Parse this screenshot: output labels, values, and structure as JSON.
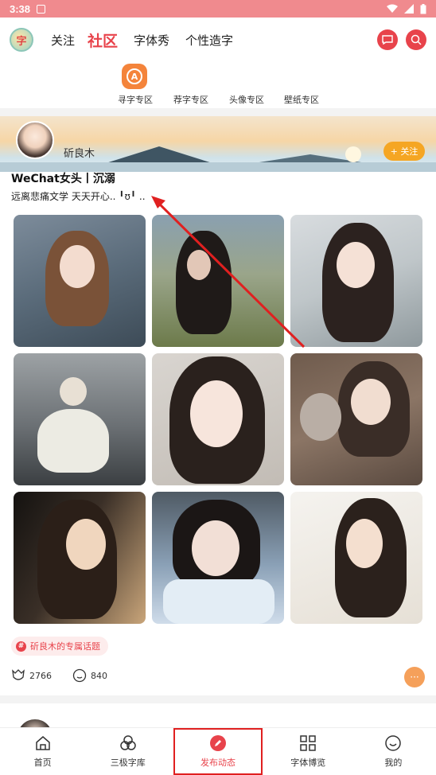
{
  "status_bar": {
    "time": "3:38"
  },
  "top_nav": {
    "logo_text": "字",
    "tabs": [
      {
        "label": "关注"
      },
      {
        "label": "社区"
      },
      {
        "label": "字体秀"
      },
      {
        "label": "个性造字"
      }
    ]
  },
  "sub_zones": [
    {
      "label": "寻字专区"
    },
    {
      "label": "荐字专区"
    },
    {
      "label": "头像专区"
    },
    {
      "label": "壁纸专区"
    }
  ],
  "post": {
    "username": "斫良木",
    "follow_label": "+ 关注",
    "title": "WeChat女头丨沉溺",
    "subtitle": "远离悲痛文学 天天开心.. ╹ʊ╹ ..",
    "tag": "斫良木的专属话题",
    "likes": "2766",
    "comments": "840",
    "more": "···"
  },
  "bottom_nav": [
    {
      "label": "首页",
      "icon": "home-icon"
    },
    {
      "label": "三极字库",
      "icon": "circles-icon"
    },
    {
      "label": "发布动态",
      "icon": "pencil-icon"
    },
    {
      "label": "字体博览",
      "icon": "grid-icon"
    },
    {
      "label": "我的",
      "icon": "smile-icon"
    }
  ],
  "colors": {
    "accent": "#e8434b",
    "status_bar": "#f08a8e",
    "follow": "#f5a623"
  }
}
